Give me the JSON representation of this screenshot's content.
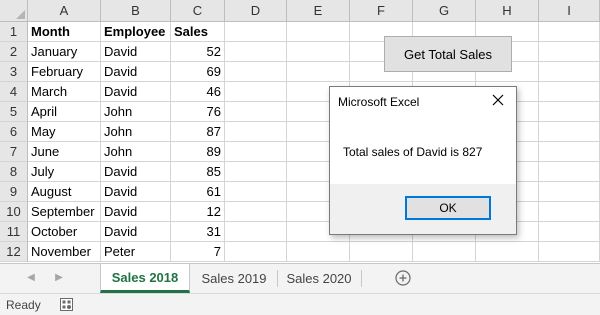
{
  "columns": [
    "A",
    "B",
    "C",
    "D",
    "E",
    "F",
    "G",
    "H",
    "I"
  ],
  "rows": [
    "1",
    "2",
    "3",
    "4",
    "5",
    "6",
    "7",
    "8",
    "9",
    "10",
    "11",
    "12"
  ],
  "table": {
    "headers": [
      "Month",
      "Employee",
      "Sales"
    ],
    "records": [
      [
        "January",
        "David",
        "52"
      ],
      [
        "February",
        "David",
        "69"
      ],
      [
        "March",
        "David",
        "46"
      ],
      [
        "April",
        "John",
        "76"
      ],
      [
        "May",
        "John",
        "87"
      ],
      [
        "June",
        "John",
        "89"
      ],
      [
        "July",
        "David",
        "85"
      ],
      [
        "August",
        "David",
        "61"
      ],
      [
        "September",
        "David",
        "12"
      ],
      [
        "October",
        "David",
        "31"
      ],
      [
        "November",
        "Peter",
        "7"
      ]
    ]
  },
  "button": {
    "label": "Get Total Sales"
  },
  "dialog": {
    "title": "Microsoft Excel",
    "message": "Total sales of David is 827",
    "ok_label": "OK"
  },
  "tabs": [
    {
      "label": "Sales 2018",
      "active": true
    },
    {
      "label": "Sales 2019",
      "active": false
    },
    {
      "label": "Sales 2020",
      "active": false
    }
  ],
  "status": {
    "text": "Ready"
  },
  "icons": {
    "nav_prev": "chevron-left-icon",
    "nav_next": "chevron-right-icon",
    "add_sheet": "plus-circle-icon",
    "close": "close-icon",
    "macro_status": "macro-record-icon"
  },
  "colors": {
    "accent": "#217346",
    "dialog_focus": "#0078d7"
  }
}
